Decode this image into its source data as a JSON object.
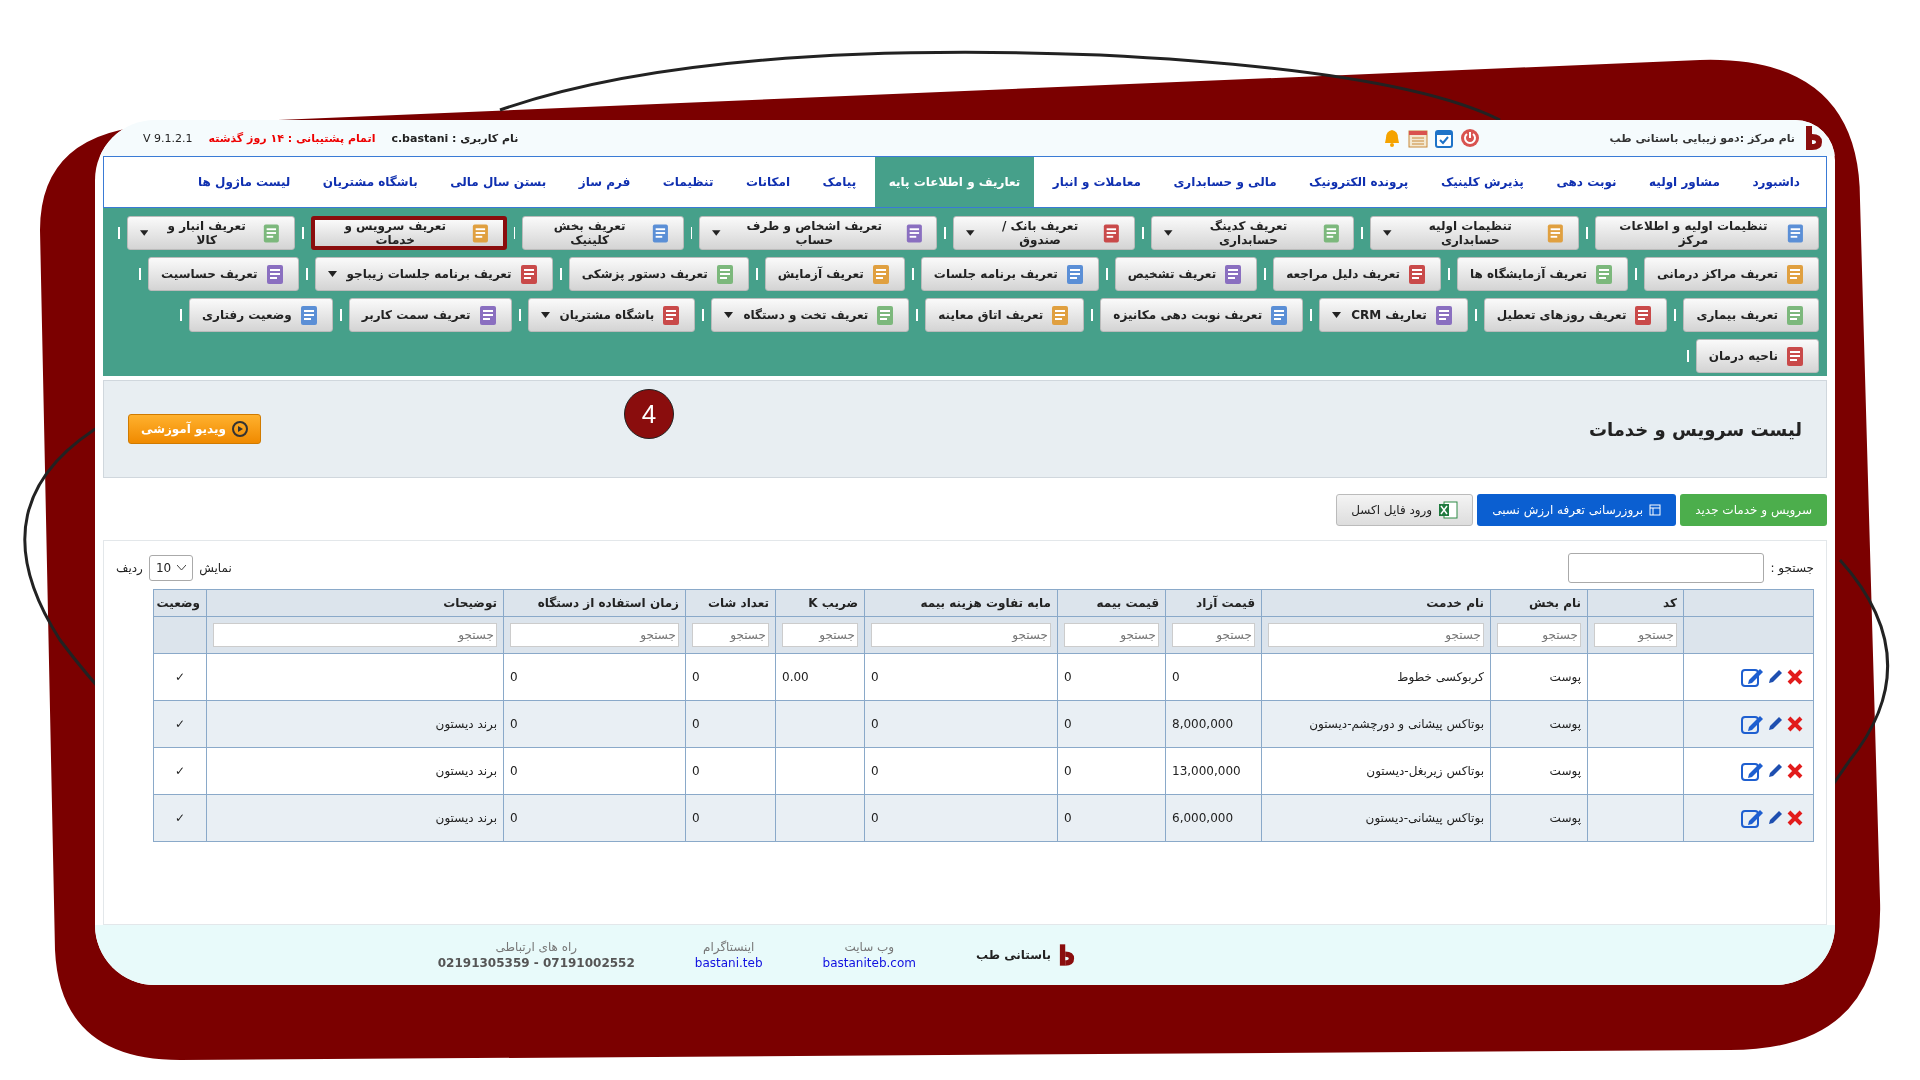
{
  "top_bar": {
    "center_name": "نام مرکز :دمو زیبایی باستانی طب",
    "user": "نام کاربری : c.bastani",
    "support": "اتمام پشتیبانی : ۱۴ روز گذشته",
    "version": "V 9.1.2.1"
  },
  "nav": [
    {
      "label": "داشبورد",
      "selected": false
    },
    {
      "label": "مشاور اولیه",
      "selected": false
    },
    {
      "label": "نوبت دهی",
      "selected": false
    },
    {
      "label": "پذیرش کلینیک",
      "selected": false
    },
    {
      "label": "پرونده الکترونیک",
      "selected": false
    },
    {
      "label": "مالی و حسابداری",
      "selected": false
    },
    {
      "label": "معاملات و انبار",
      "selected": false
    },
    {
      "label": "تعاریف و اطلاعات پایه",
      "selected": true
    },
    {
      "label": "پیامک",
      "selected": false
    },
    {
      "label": "امکانات",
      "selected": false
    },
    {
      "label": "تنظیمات",
      "selected": false
    },
    {
      "label": "فرم ساز",
      "selected": false
    },
    {
      "label": "بستن سال مالی",
      "selected": false
    },
    {
      "label": "باشگاه مشتریان",
      "selected": false
    },
    {
      "label": "لیست ماژول ها",
      "selected": false
    }
  ],
  "toolbar_rows": [
    [
      {
        "label": "تنظیمات اولیه و اطلاعات مرکز",
        "dropdown": false,
        "selected": false
      },
      {
        "label": "تنظیمات اولیه حسابداری",
        "dropdown": true,
        "selected": false
      },
      {
        "label": "تعریف کدینگ حسابداری",
        "dropdown": true,
        "selected": false
      },
      {
        "label": "تعریف بانک /صندوق",
        "dropdown": true,
        "selected": false
      },
      {
        "label": "تعریف اشخاص و طرف حساب",
        "dropdown": true,
        "selected": false
      },
      {
        "label": "تعریف بخش کلینیک",
        "dropdown": false,
        "selected": false
      },
      {
        "label": "تعریف سرویس و خدمات",
        "dropdown": false,
        "selected": true
      },
      {
        "label": "تعریف انبار و کالا",
        "dropdown": true,
        "selected": false
      }
    ],
    [
      {
        "label": "تعریف مراکز درمانی",
        "dropdown": false,
        "selected": false
      },
      {
        "label": "تعریف آزمایشگاه ها",
        "dropdown": false,
        "selected": false
      },
      {
        "label": "تعریف دلیل مراجعه",
        "dropdown": false,
        "selected": false
      },
      {
        "label": "تعریف تشخیص",
        "dropdown": false,
        "selected": false
      },
      {
        "label": "تعریف برنامه جلسات",
        "dropdown": false,
        "selected": false
      },
      {
        "label": "تعریف آزمایش",
        "dropdown": false,
        "selected": false
      },
      {
        "label": "تعریف دستور پزشکی",
        "dropdown": false,
        "selected": false
      },
      {
        "label": "تعریف برنامه جلسات زیباجو",
        "dropdown": true,
        "selected": false
      },
      {
        "label": "تعریف حساسیت",
        "dropdown": false,
        "selected": false
      }
    ],
    [
      {
        "label": "تعریف بیماری",
        "dropdown": false,
        "selected": false
      },
      {
        "label": "تعریف روزهای تعطیل",
        "dropdown": false,
        "selected": false
      },
      {
        "label": "تعاریف CRM",
        "dropdown": true,
        "selected": false
      },
      {
        "label": "تعریف نوبت دهی مکانیزه",
        "dropdown": false,
        "selected": false
      },
      {
        "label": "تعریف اتاق معاینه",
        "dropdown": false,
        "selected": false
      },
      {
        "label": "تعریف تخت و دستگاه",
        "dropdown": true,
        "selected": false
      },
      {
        "label": "باشگاه مشتریان",
        "dropdown": true,
        "selected": false
      },
      {
        "label": "تعریف سمت کاربر",
        "dropdown": false,
        "selected": false
      },
      {
        "label": "وضعیت رفتاری",
        "dropdown": false,
        "selected": false
      }
    ],
    [
      {
        "label": "ناحیه درمان",
        "dropdown": false,
        "selected": false
      }
    ]
  ],
  "step_badge": "4",
  "page_header": {
    "title": "لیست سرویس و خدمات",
    "video_button": "ویدیو آموزشی"
  },
  "actions": [
    {
      "kind": "new",
      "label": "سرویس و خدمات جدید"
    },
    {
      "kind": "update",
      "label": "بروزرسانی تعرفه ارزش نسبی"
    },
    {
      "kind": "excel",
      "label": "ورود فایل اکسل"
    }
  ],
  "table": {
    "search_label": "جستجو :",
    "show_label": "نمایش",
    "page_size": "10",
    "rows_label": "ردیف",
    "columns": [
      {
        "label": "کد",
        "filter_placeholder": "جستجو"
      },
      {
        "label": "نام بخش",
        "filter_placeholder": "جستجو"
      },
      {
        "label": "نام خدمت",
        "filter_placeholder": "جستجو"
      },
      {
        "label": "قیمت آزاد",
        "filter_placeholder": "جستجو"
      },
      {
        "label": "قیمت بیمه",
        "filter_placeholder": "جستجو"
      },
      {
        "label": "مابه تفاوت هزینه بیمه",
        "filter_placeholder": "جستجو"
      },
      {
        "label": "ضریب K",
        "filter_placeholder": "جستجو"
      },
      {
        "label": "تعداد شات",
        "filter_placeholder": "جستجو"
      },
      {
        "label": "زمان استفاده از دستگاه",
        "filter_placeholder": "جستجو"
      },
      {
        "label": "توضیحات",
        "filter_placeholder": "جستجو"
      },
      {
        "label": "وضعیت"
      }
    ],
    "rows": [
      {
        "department": "پوست",
        "service": "کربوکسی خطوط",
        "free_price": "0",
        "insurance_price": "0",
        "difference": "0",
        "k": "0.00",
        "shots": "0",
        "device_time": "0",
        "status": "✓"
      },
      {
        "department": "پوست",
        "service": "بوتاکس پیشانی و دورچشم-دیستون",
        "free_price": "8,000,000",
        "insurance_price": "0",
        "difference": "0",
        "shots": "0",
        "device_time": "0",
        "description": "برند دیستون",
        "status": "✓"
      },
      {
        "department": "پوست",
        "service": "بوتاکس زیربغل-دیستون",
        "free_price": "13,000,000",
        "insurance_price": "0",
        "difference": "0",
        "shots": "0",
        "device_time": "0",
        "description": "برند دیستون",
        "status": "✓"
      },
      {
        "department": "پوست",
        "service": "بوتاکس پیشانی-دیستون",
        "free_price": "6,000,000",
        "insurance_price": "0",
        "difference": "0",
        "shots": "0",
        "device_time": "0",
        "description": "برند دیستون",
        "status": "✓"
      }
    ]
  },
  "footer": {
    "brand": "باستانی طب",
    "website_label": "وب سایت",
    "website": "bastaniteb.com",
    "instagram_label": "اینستاگرام",
    "instagram": "bastani.teb",
    "contact_label": "راه های ارتباطی",
    "phones": "07191002552 - 02191305359"
  }
}
